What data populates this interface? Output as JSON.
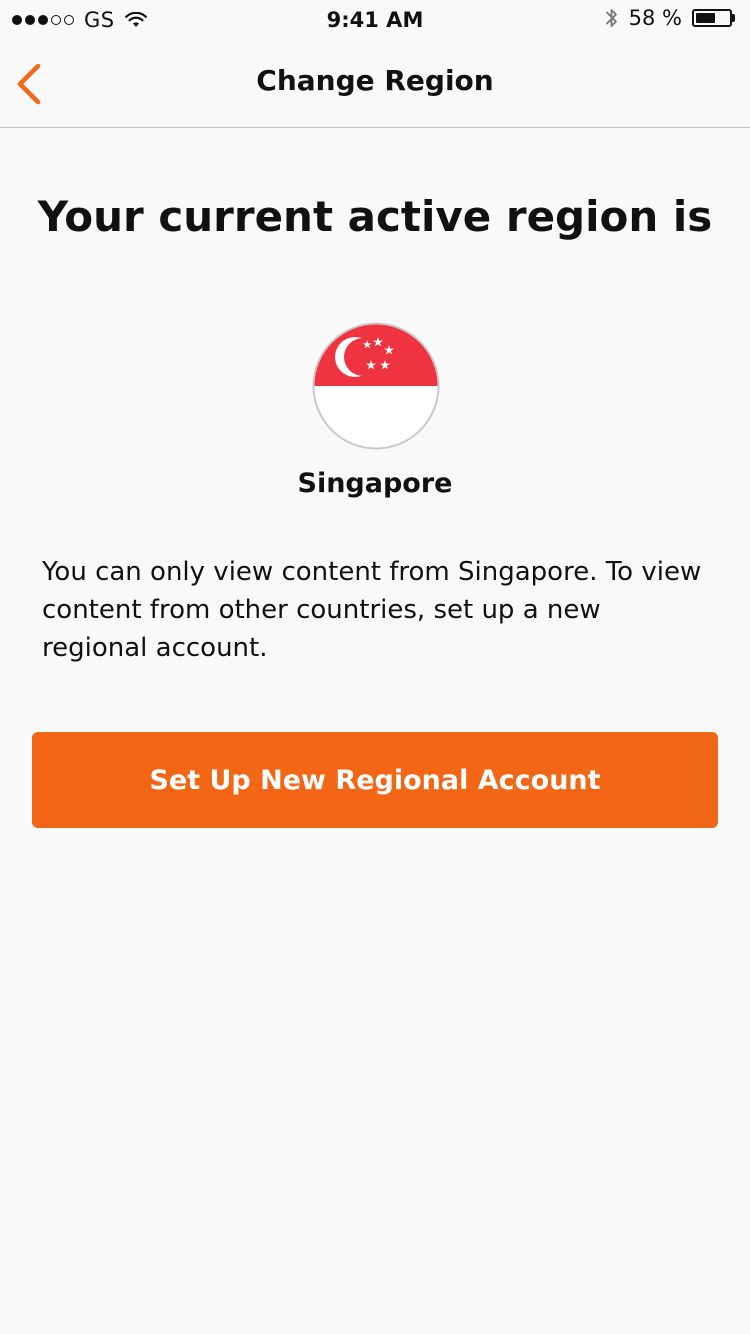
{
  "status_bar": {
    "carrier": "GS",
    "time": "9:41 AM",
    "battery_label": "58 %",
    "battery_level": 0.58,
    "signal_strength": 3,
    "signal_max": 5
  },
  "nav": {
    "title": "Change Region",
    "back_icon": "chevron-left-icon"
  },
  "main": {
    "headline": "Your current active region is",
    "flag_icon": "singapore-flag-icon",
    "country": "Singapore",
    "description": "You can only view content from Singapore. To view content from other countries, set up a new regional account.",
    "button_label": "Set Up New Regional Account"
  },
  "colors": {
    "accent": "#f26615",
    "flag_red": "#ef3340",
    "background": "#f9f9f9"
  }
}
